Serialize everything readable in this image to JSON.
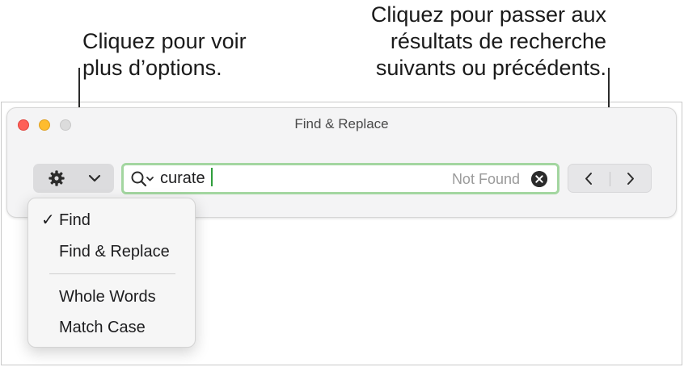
{
  "callouts": {
    "options_line1": "Cliquez pour voir",
    "options_line2": "plus d’options.",
    "results_line1": "Cliquez pour passer aux",
    "results_line2": "résultats de recherche",
    "results_line3": "suivants ou précédents."
  },
  "window": {
    "title": "Find & Replace"
  },
  "search": {
    "value": "curate",
    "status": "Not Found"
  },
  "menu": {
    "items": [
      {
        "label": "Find",
        "check": "✓"
      },
      {
        "label": "Find & Replace"
      },
      {
        "label": "Whole Words"
      },
      {
        "label": "Match Case"
      }
    ]
  },
  "colors": {
    "accent_field_border": "#a3d6a0",
    "caret": "#2f9e3c",
    "close": "#fe5f57",
    "minimize": "#febc2e"
  },
  "icons": [
    "gear-icon",
    "chevron-down-icon",
    "magnifier-icon",
    "clear-icon",
    "chevron-left-icon",
    "chevron-right-icon",
    "checkmark-icon"
  ]
}
